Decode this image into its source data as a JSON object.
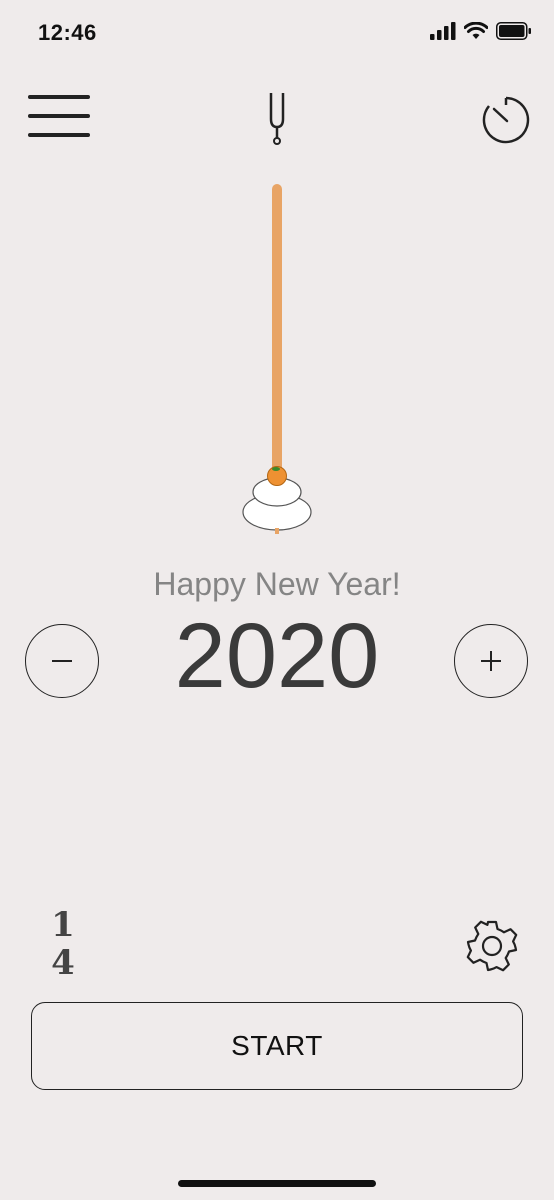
{
  "status": {
    "time": "12:46"
  },
  "toolbar": {
    "menu_icon": "hamburger-menu-icon",
    "tuner_icon": "tuning-fork-icon",
    "timer_icon": "stopwatch-icon"
  },
  "pendulum": {
    "rod_color": "#e8a465",
    "bob": "kagami-mochi-icon"
  },
  "main": {
    "subtitle": "Happy New Year!",
    "tempo": "2020",
    "minus_label": "−",
    "plus_label": "+"
  },
  "footer": {
    "time_signature": {
      "numerator": "1",
      "denominator": "4"
    },
    "settings_icon": "gear-icon",
    "start_label": "START"
  }
}
